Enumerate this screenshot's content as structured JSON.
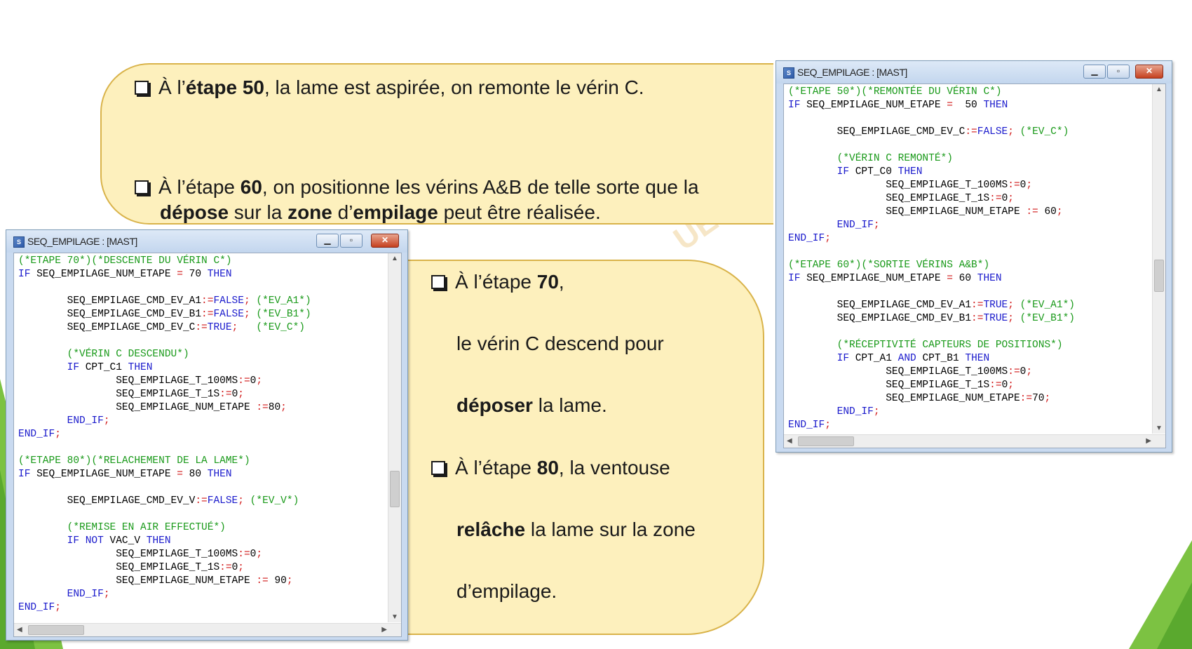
{
  "watermark": "UE",
  "bubble_top": {
    "l1": {
      "pre": "À l’",
      "b": "étape 50",
      "post": ", la lame est aspirée, on remonte le vérin C."
    },
    "l2": {
      "pre": "À l’étape ",
      "b": "60",
      "post": ", on positionne les vérins A&B de telle sorte que la"
    },
    "l3": {
      "b1": "dépose",
      "m1": " sur la ",
      "b2": "zone",
      "m2": " d’",
      "b3": "empilage",
      "post": " peut être réalisée."
    }
  },
  "bubble_mid": {
    "l1": {
      "pre": "À l’étape ",
      "b": "70",
      "post": ","
    },
    "l2": "le vérin C descend pour",
    "l3": {
      "b": "déposer",
      "post": " la lame."
    },
    "l4": {
      "pre": "À l’étape ",
      "b": "80",
      "post": ", la ventouse"
    },
    "l5": {
      "b": "relâche",
      "post": " la lame sur la zone"
    },
    "l6": "d’empilage."
  },
  "win_right": {
    "title": "SEQ_EMPILAGE : [MAST]",
    "code": [
      [
        [
          "c",
          "(*ETAPE 50*)(*REMONTÉE DU VÉRIN C*)"
        ]
      ],
      [
        [
          "k",
          "IF"
        ],
        [
          "n",
          " SEQ_EMPILAGE_NUM_ETAPE "
        ],
        [
          "o",
          "="
        ],
        [
          "n",
          "  50 "
        ],
        [
          "k",
          "THEN"
        ]
      ],
      [],
      [
        [
          "n",
          "        SEQ_EMPILAGE_CMD_EV_C"
        ],
        [
          "o",
          ":="
        ],
        [
          "k",
          "FALSE"
        ],
        [
          "o",
          ";"
        ],
        [
          "c",
          " (*EV_C*)"
        ]
      ],
      [],
      [
        [
          "c",
          "        (*VÉRIN C REMONTÉ*)"
        ]
      ],
      [
        [
          "k",
          "        IF"
        ],
        [
          "n",
          " CPT_C0 "
        ],
        [
          "k",
          "THEN"
        ]
      ],
      [
        [
          "n",
          "                SEQ_EMPILAGE_T_100MS"
        ],
        [
          "o",
          ":="
        ],
        [
          "n",
          "0"
        ],
        [
          "o",
          ";"
        ]
      ],
      [
        [
          "n",
          "                SEQ_EMPILAGE_T_1S"
        ],
        [
          "o",
          ":="
        ],
        [
          "n",
          "0"
        ],
        [
          "o",
          ";"
        ]
      ],
      [
        [
          "n",
          "                SEQ_EMPILAGE_NUM_ETAPE "
        ],
        [
          "o",
          ":="
        ],
        [
          "n",
          " 60"
        ],
        [
          "o",
          ";"
        ]
      ],
      [
        [
          "k",
          "        END_IF"
        ],
        [
          "o",
          ";"
        ]
      ],
      [
        [
          "k",
          "END_IF"
        ],
        [
          "o",
          ";"
        ]
      ],
      [],
      [
        [
          "c",
          "(*ETAPE 60*)(*SORTIE VÉRINS A&B*)"
        ]
      ],
      [
        [
          "k",
          "IF"
        ],
        [
          "n",
          " SEQ_EMPILAGE_NUM_ETAPE "
        ],
        [
          "o",
          "="
        ],
        [
          "n",
          " 60 "
        ],
        [
          "k",
          "THEN"
        ]
      ],
      [],
      [
        [
          "n",
          "        SEQ_EMPILAGE_CMD_EV_A1"
        ],
        [
          "o",
          ":="
        ],
        [
          "k",
          "TRUE"
        ],
        [
          "o",
          ";"
        ],
        [
          "c",
          " (*EV_A1*)"
        ]
      ],
      [
        [
          "n",
          "        SEQ_EMPILAGE_CMD_EV_B1"
        ],
        [
          "o",
          ":="
        ],
        [
          "k",
          "TRUE"
        ],
        [
          "o",
          ";"
        ],
        [
          "c",
          " (*EV_B1*)"
        ]
      ],
      [],
      [
        [
          "c",
          "        (*RÉCEPTIVITÉ CAPTEURS DE POSITIONS*)"
        ]
      ],
      [
        [
          "k",
          "        IF"
        ],
        [
          "n",
          " CPT_A1 "
        ],
        [
          "k",
          "AND"
        ],
        [
          "n",
          " CPT_B1 "
        ],
        [
          "k",
          "THEN"
        ]
      ],
      [
        [
          "n",
          "                SEQ_EMPILAGE_T_100MS"
        ],
        [
          "o",
          ":="
        ],
        [
          "n",
          "0"
        ],
        [
          "o",
          ";"
        ]
      ],
      [
        [
          "n",
          "                SEQ_EMPILAGE_T_1S"
        ],
        [
          "o",
          ":="
        ],
        [
          "n",
          "0"
        ],
        [
          "o",
          ";"
        ]
      ],
      [
        [
          "n",
          "                SEQ_EMPILAGE_NUM_ETAPE"
        ],
        [
          "o",
          ":="
        ],
        [
          "n",
          "70"
        ],
        [
          "o",
          ";"
        ]
      ],
      [
        [
          "k",
          "        END_IF"
        ],
        [
          "o",
          ";"
        ]
      ],
      [
        [
          "k",
          "END_IF"
        ],
        [
          "o",
          ";"
        ]
      ]
    ]
  },
  "win_left": {
    "title": "SEQ_EMPILAGE : [MAST]",
    "code": [
      [
        [
          "c",
          "(*ETAPE 70*)(*DESCENTE DU VÉRIN C*)"
        ]
      ],
      [
        [
          "k",
          "IF"
        ],
        [
          "n",
          " SEQ_EMPILAGE_NUM_ETAPE "
        ],
        [
          "o",
          "="
        ],
        [
          "n",
          " 70 "
        ],
        [
          "k",
          "THEN"
        ]
      ],
      [],
      [
        [
          "n",
          "        SEQ_EMPILAGE_CMD_EV_A1"
        ],
        [
          "o",
          ":="
        ],
        [
          "k",
          "FALSE"
        ],
        [
          "o",
          ";"
        ],
        [
          "c",
          " (*EV_A1*)"
        ]
      ],
      [
        [
          "n",
          "        SEQ_EMPILAGE_CMD_EV_B1"
        ],
        [
          "o",
          ":="
        ],
        [
          "k",
          "FALSE"
        ],
        [
          "o",
          ";"
        ],
        [
          "c",
          " (*EV_B1*)"
        ]
      ],
      [
        [
          "n",
          "        SEQ_EMPILAGE_CMD_EV_C"
        ],
        [
          "o",
          ":="
        ],
        [
          "k",
          "TRUE"
        ],
        [
          "o",
          ";"
        ],
        [
          "c",
          "   (*EV_C*)"
        ]
      ],
      [],
      [
        [
          "c",
          "        (*VÉRIN C DESCENDU*)"
        ]
      ],
      [
        [
          "k",
          "        IF"
        ],
        [
          "n",
          " CPT_C1 "
        ],
        [
          "k",
          "THEN"
        ]
      ],
      [
        [
          "n",
          "                SEQ_EMPILAGE_T_100MS"
        ],
        [
          "o",
          ":="
        ],
        [
          "n",
          "0"
        ],
        [
          "o",
          ";"
        ]
      ],
      [
        [
          "n",
          "                SEQ_EMPILAGE_T_1S"
        ],
        [
          "o",
          ":="
        ],
        [
          "n",
          "0"
        ],
        [
          "o",
          ";"
        ]
      ],
      [
        [
          "n",
          "                SEQ_EMPILAGE_NUM_ETAPE "
        ],
        [
          "o",
          ":="
        ],
        [
          "n",
          "80"
        ],
        [
          "o",
          ";"
        ]
      ],
      [
        [
          "k",
          "        END_IF"
        ],
        [
          "o",
          ";"
        ]
      ],
      [
        [
          "k",
          "END_IF"
        ],
        [
          "o",
          ";"
        ]
      ],
      [],
      [
        [
          "c",
          "(*ETAPE 80*)(*RELACHEMENT DE LA LAME*)"
        ]
      ],
      [
        [
          "k",
          "IF"
        ],
        [
          "n",
          " SEQ_EMPILAGE_NUM_ETAPE "
        ],
        [
          "o",
          "="
        ],
        [
          "n",
          " 80 "
        ],
        [
          "k",
          "THEN"
        ]
      ],
      [],
      [
        [
          "n",
          "        SEQ_EMPILAGE_CMD_EV_V"
        ],
        [
          "o",
          ":="
        ],
        [
          "k",
          "FALSE"
        ],
        [
          "o",
          ";"
        ],
        [
          "c",
          " (*EV_V*)"
        ]
      ],
      [],
      [
        [
          "c",
          "        (*REMISE EN AIR EFFECTUÉ*)"
        ]
      ],
      [
        [
          "k",
          "        IF NOT"
        ],
        [
          "n",
          " VAC_V "
        ],
        [
          "k",
          "THEN"
        ]
      ],
      [
        [
          "n",
          "                SEQ_EMPILAGE_T_100MS"
        ],
        [
          "o",
          ":="
        ],
        [
          "n",
          "0"
        ],
        [
          "o",
          ";"
        ]
      ],
      [
        [
          "n",
          "                SEQ_EMPILAGE_T_1S"
        ],
        [
          "o",
          ":="
        ],
        [
          "n",
          "0"
        ],
        [
          "o",
          ";"
        ]
      ],
      [
        [
          "n",
          "                SEQ_EMPILAGE_NUM_ETAPE "
        ],
        [
          "o",
          ":="
        ],
        [
          "n",
          " 90"
        ],
        [
          "o",
          ";"
        ]
      ],
      [
        [
          "k",
          "        END_IF"
        ],
        [
          "o",
          ";"
        ]
      ],
      [
        [
          "k",
          "END_IF"
        ],
        [
          "o",
          ";"
        ]
      ]
    ]
  }
}
